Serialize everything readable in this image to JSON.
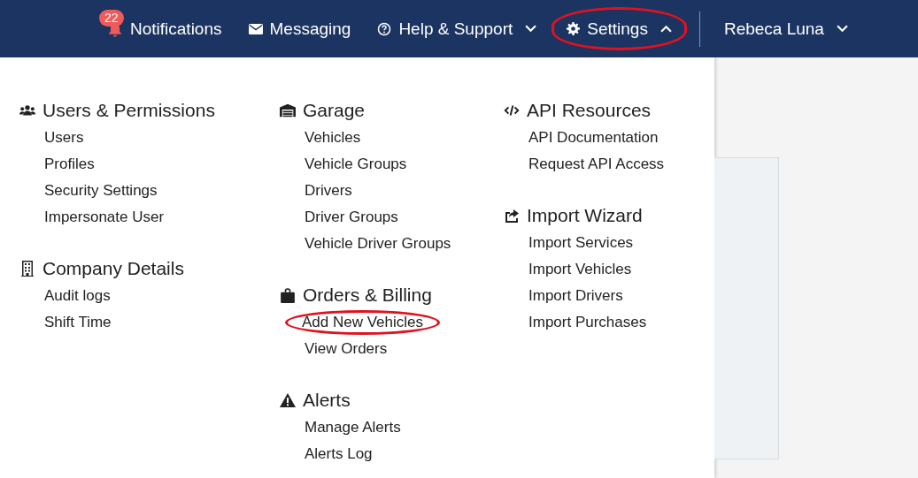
{
  "navbar": {
    "items": [
      {
        "kind": "notifications",
        "label": "Notifications",
        "badge": "22",
        "highlighted": false
      },
      {
        "kind": "messaging",
        "label": "Messaging",
        "highlighted": false
      },
      {
        "kind": "help",
        "label": "Help & Support",
        "highlighted": false,
        "expanded": false
      },
      {
        "kind": "settings",
        "label": "Settings",
        "highlighted": true,
        "expanded": true
      }
    ],
    "user": {
      "label": "Rebeca Luna",
      "expanded": false
    }
  },
  "settings_menu": {
    "columns": [
      [
        {
          "title": "Users & Permissions",
          "links": [
            {
              "label": "Users",
              "highlighted": false
            },
            {
              "label": "Profiles",
              "highlighted": false
            },
            {
              "label": "Security Settings",
              "highlighted": false
            },
            {
              "label": "Impersonate User",
              "highlighted": false
            }
          ]
        },
        {
          "title": "Company Details",
          "links": [
            {
              "label": "Audit logs",
              "highlighted": false
            },
            {
              "label": "Shift Time",
              "highlighted": false
            }
          ]
        }
      ],
      [
        {
          "title": "Garage",
          "links": [
            {
              "label": "Vehicles",
              "highlighted": false
            },
            {
              "label": "Vehicle Groups",
              "highlighted": false
            },
            {
              "label": "Drivers",
              "highlighted": false
            },
            {
              "label": "Driver Groups",
              "highlighted": false
            },
            {
              "label": "Vehicle Driver Groups",
              "highlighted": false
            }
          ]
        },
        {
          "title": "Orders & Billing",
          "links": [
            {
              "label": "Add New Vehicles",
              "highlighted": true
            },
            {
              "label": "View Orders",
              "highlighted": false
            }
          ]
        },
        {
          "title": "Alerts",
          "links": [
            {
              "label": "Manage Alerts",
              "highlighted": false
            },
            {
              "label": "Alerts Log",
              "highlighted": false
            }
          ]
        }
      ],
      [
        {
          "title": "API Resources",
          "links": [
            {
              "label": "API Documentation",
              "highlighted": false
            },
            {
              "label": "Request API Access",
              "highlighted": false
            }
          ]
        },
        {
          "title": "Import Wizard",
          "links": [
            {
              "label": "Import Services",
              "highlighted": false
            },
            {
              "label": "Import Vehicles",
              "highlighted": false
            },
            {
              "label": "Import Drivers",
              "highlighted": false
            },
            {
              "label": "Import Purchases",
              "highlighted": false
            }
          ]
        }
      ]
    ]
  }
}
